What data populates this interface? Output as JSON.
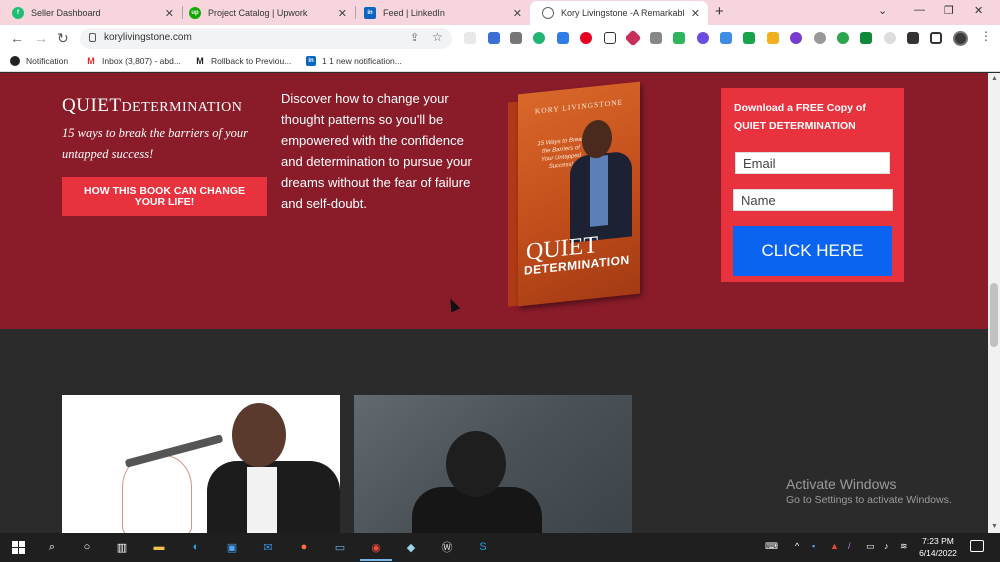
{
  "browser": {
    "tabs": [
      {
        "title": "Seller Dashboard",
        "icon": "fiverr-icon",
        "color": "#1dbf73"
      },
      {
        "title": "Project Catalog | Upwork",
        "icon": "upwork-icon",
        "color": "#14a800"
      },
      {
        "title": "Feed | LinkedIn",
        "icon": "linkedin-icon",
        "color": "#0a66c2"
      },
      {
        "title": "Kory Livingstone -A Remarkable",
        "icon": "globe-icon",
        "color": "#5f6368"
      }
    ],
    "url": "korylivingstone.com",
    "bookmarks": [
      {
        "label": "Notification",
        "icon": "github-icon"
      },
      {
        "label": "Inbox (3,807) - abd...",
        "icon": "gmail-icon"
      },
      {
        "label": "Rollback to Previou...",
        "icon": "elementor-icon"
      },
      {
        "label": "1 1 new notification...",
        "icon": "linkedin-icon"
      }
    ]
  },
  "hero": {
    "brand_big": "QUIET",
    "brand_small": "DETERMINATION",
    "tagline": "15 ways to break the barriers of your untapped success!",
    "cta_label": "HOW THIS BOOK CAN CHANGE YOUR LIFE!",
    "description": "Discover how to change your thought patterns so you'll be empowered with the confidence and determination to pursue your dreams without the fear of failure and self-doubt.",
    "book": {
      "author": "KORY LIVINGSTONE",
      "subtitle": "15 Ways to Break the Barriers of Your Untapped Success!",
      "title_line1": "QUIET",
      "title_line2": "DETERMINATION"
    }
  },
  "signup": {
    "title_prefix": "Download a FREE Copy of",
    "title_book": "QUIET DETERMINATION",
    "email_placeholder": "Email",
    "name_placeholder": "Name",
    "button_label": "CLICK HERE"
  },
  "windows_watermark": {
    "line1": "Activate Windows",
    "line2": "Go to Settings to activate Windows."
  },
  "taskbar": {
    "time": "7:23 PM",
    "date": "6/14/2022"
  },
  "colors": {
    "hero_bg": "#8a1c2a",
    "accent_red": "#e8333f",
    "button_blue": "#0b63f2",
    "dark_bg": "#2b2b2b"
  }
}
